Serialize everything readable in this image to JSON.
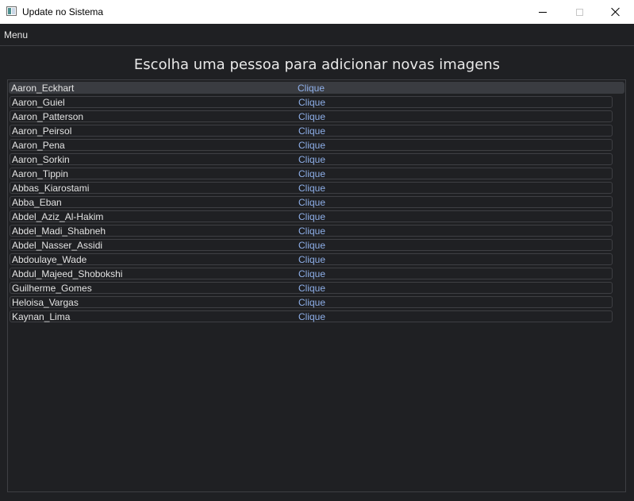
{
  "window": {
    "title": "Update no Sistema"
  },
  "menu": {
    "label": "Menu"
  },
  "heading": "Escolha uma pessoa para adicionar novas imagens",
  "selected_index": 0,
  "colors": {
    "background": "#1f2023",
    "link": "#8fb0ea",
    "selected_row": "#3a3c41",
    "text": "#e4e4e4"
  },
  "people": [
    {
      "name": "Aaron_Eckhart",
      "action": "Clique"
    },
    {
      "name": "Aaron_Guiel",
      "action": "Clique"
    },
    {
      "name": "Aaron_Patterson",
      "action": "Clique"
    },
    {
      "name": "Aaron_Peirsol",
      "action": "Clique"
    },
    {
      "name": "Aaron_Pena",
      "action": "Clique"
    },
    {
      "name": "Aaron_Sorkin",
      "action": "Clique"
    },
    {
      "name": "Aaron_Tippin",
      "action": "Clique"
    },
    {
      "name": "Abbas_Kiarostami",
      "action": "Clique"
    },
    {
      "name": "Abba_Eban",
      "action": "Clique"
    },
    {
      "name": "Abdel_Aziz_Al-Hakim",
      "action": "Clique"
    },
    {
      "name": "Abdel_Madi_Shabneh",
      "action": "Clique"
    },
    {
      "name": "Abdel_Nasser_Assidi",
      "action": "Clique"
    },
    {
      "name": "Abdoulaye_Wade",
      "action": "Clique"
    },
    {
      "name": "Abdul_Majeed_Shobokshi",
      "action": "Clique"
    },
    {
      "name": "Guilherme_Gomes",
      "action": "Clique"
    },
    {
      "name": "Heloisa_Vargas",
      "action": "Clique"
    },
    {
      "name": "Kaynan_Lima",
      "action": "Clique"
    }
  ]
}
